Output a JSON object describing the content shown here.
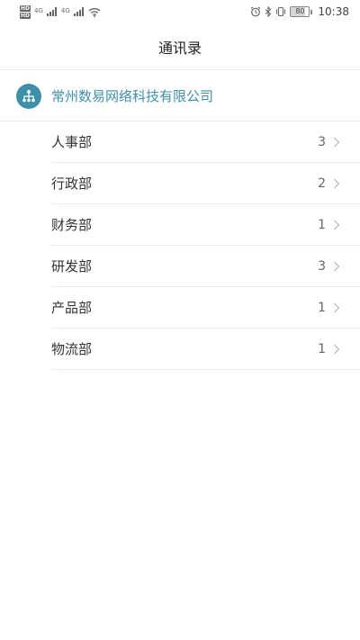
{
  "status_bar": {
    "hd_top": "HD",
    "hd_bottom": "HD",
    "net_1": "4G",
    "net_2": "4G",
    "battery": "80",
    "time": "10:38"
  },
  "header": {
    "title": "通讯录"
  },
  "organization": {
    "name": "常州数易网络科技有限公司",
    "icon": "org-chart-icon",
    "accent_color": "#3f8fa8"
  },
  "departments": [
    {
      "name": "人事部",
      "count": "3"
    },
    {
      "name": "行政部",
      "count": "2"
    },
    {
      "name": "财务部",
      "count": "1"
    },
    {
      "name": "研发部",
      "count": "3"
    },
    {
      "name": "产品部",
      "count": "1"
    },
    {
      "name": "物流部",
      "count": "1"
    }
  ]
}
